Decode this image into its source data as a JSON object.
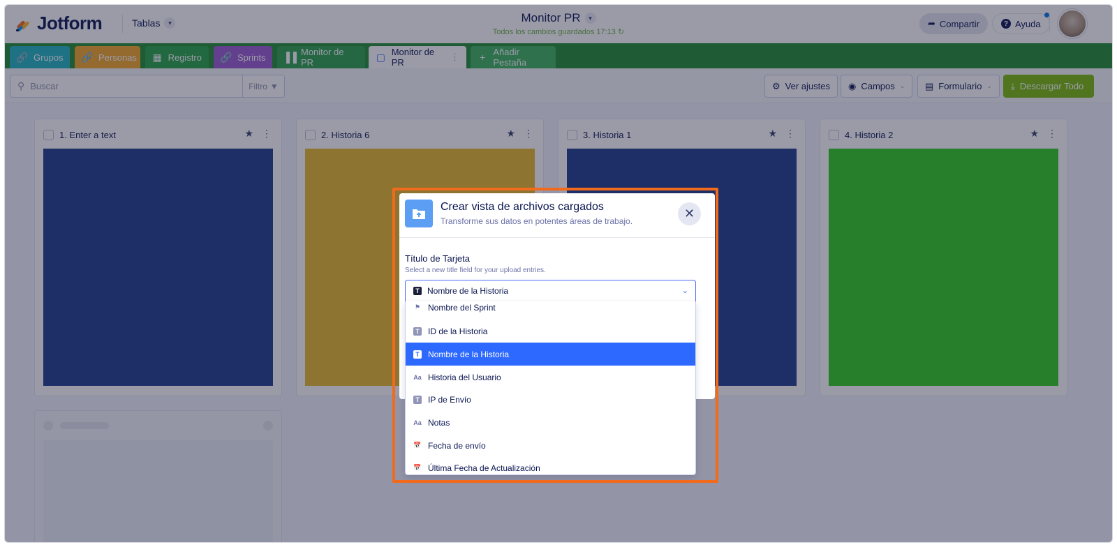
{
  "app": {
    "logo_text": "Jotform",
    "workspace_label": "Tablas",
    "title": "Monitor PR",
    "save_status": "Todos los cambios guardados 17:13",
    "share_label": "Compartir",
    "help_label": "Ayuda"
  },
  "tabs": [
    {
      "label": "Grupos",
      "icon": "link-icon",
      "color": "#1fb5c0"
    },
    {
      "label": "Personas",
      "icon": "link-icon",
      "color": "#f5a623"
    },
    {
      "label": "Registro",
      "icon": "grid-icon",
      "color": "#25a244"
    },
    {
      "label": "Sprints",
      "icon": "link-icon",
      "color": "#9b59d0"
    },
    {
      "label": "Monitor de PR",
      "icon": "report-icon",
      "color": "#2ba04a"
    },
    {
      "label": "Monitor de PR",
      "icon": "upload-view-icon",
      "color": "#ffffff",
      "active": true
    },
    {
      "label": "Añadir Pestaña",
      "icon": "plus-icon",
      "color": "#3bb35a"
    }
  ],
  "toolbar": {
    "search_placeholder": "Buscar",
    "filter_label": "Filtro",
    "settings_label": "Ver ajustes",
    "fields_label": "Campos",
    "form_label": "Formulario",
    "download_label": "Descargar Todo"
  },
  "cards": [
    {
      "title": "1. Enter a text",
      "image_color": "#1e3a8a"
    },
    {
      "title": "2. Historia 6",
      "image_color": "#e8b928"
    },
    {
      "title": "3. Historia 1",
      "image_color": "#1e3a8a"
    },
    {
      "title": "4. Historia 2",
      "image_color": "#2ecc1f"
    }
  ],
  "modal": {
    "title": "Crear vista de archivos cargados",
    "subtitle": "Transforme sus datos en potentes áreas de trabajo.",
    "field_label": "Título de Tarjeta",
    "field_hint": "Select a new title field for your upload entries.",
    "selected_value": "Nombre de la Historia",
    "options": [
      {
        "label": "Nombre del Sprint",
        "icon": "tag-icon"
      },
      {
        "label": "ID de la Historia",
        "icon": "text-icon"
      },
      {
        "label": "Nombre de la Historia",
        "icon": "text-icon",
        "selected": true
      },
      {
        "label": "Historia del Usuario",
        "icon": "textarea-icon"
      },
      {
        "label": "IP de Envío",
        "icon": "text-icon"
      },
      {
        "label": "Notas",
        "icon": "textarea-icon"
      },
      {
        "label": "Fecha de envío",
        "icon": "calendar-icon"
      },
      {
        "label": "Última Fecha de Actualización",
        "icon": "calendar-icon"
      }
    ]
  },
  "colors": {
    "brand_navy": "#0a1551",
    "tab_bar_green": "#1f8a2f",
    "selected_blue": "#2e69ff",
    "highlight_orange": "#f26a1b",
    "download_green": "#78bb07"
  }
}
